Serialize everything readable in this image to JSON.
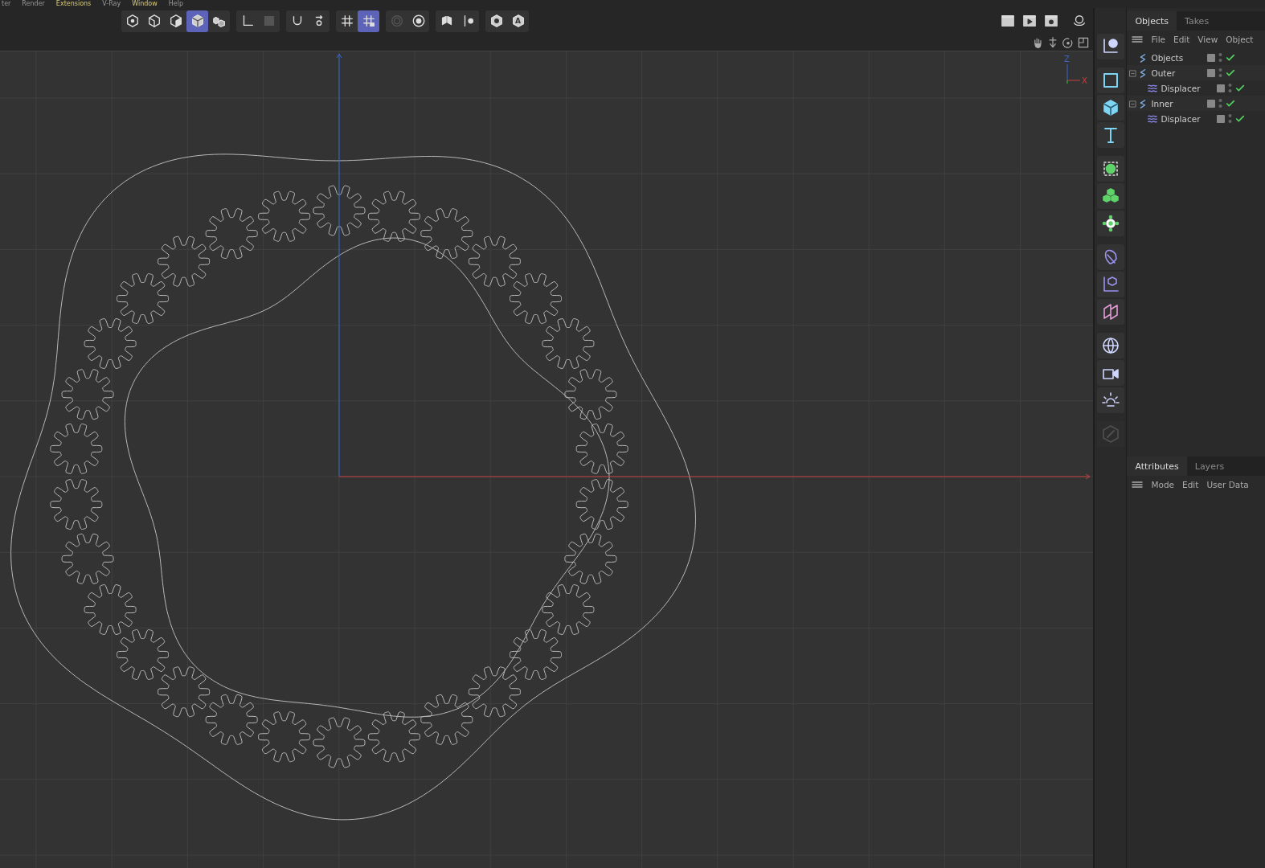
{
  "menu": [
    {
      "label": "ter",
      "highlighted": false
    },
    {
      "label": "Render",
      "highlighted": false
    },
    {
      "label": "Extensions",
      "highlighted": true
    },
    {
      "label": "V-Ray",
      "highlighted": false
    },
    {
      "label": "Window",
      "highlighted": true
    },
    {
      "label": "Help",
      "highlighted": false
    }
  ],
  "toolbar": {
    "groups": [
      {
        "tools": [
          {
            "selected": false,
            "disabled": false
          },
          {
            "selected": false,
            "disabled": false
          },
          {
            "selected": false,
            "disabled": false
          },
          {
            "selected": true,
            "disabled": false
          },
          {
            "selected": false,
            "disabled": false
          }
        ]
      },
      {
        "tools": [
          {
            "selected": false,
            "disabled": false
          },
          {
            "selected": false,
            "disabled": true
          }
        ]
      },
      {
        "tools": [
          {
            "selected": false,
            "disabled": false
          },
          {
            "selected": false,
            "disabled": false
          }
        ]
      },
      {
        "tools": [
          {
            "selected": false,
            "disabled": false
          },
          {
            "selected": true,
            "disabled": false
          }
        ]
      },
      {
        "tools": [
          {
            "selected": false,
            "disabled": true
          },
          {
            "selected": false,
            "disabled": false
          }
        ]
      },
      {
        "tools": [
          {
            "selected": false,
            "disabled": false
          },
          {
            "selected": false,
            "disabled": false
          }
        ]
      },
      {
        "tools": [
          {
            "selected": false,
            "disabled": false
          },
          {
            "selected": false,
            "disabled": false,
            "label": "A"
          }
        ]
      }
    ],
    "render_tools": [
      {
        "selected": false,
        "disabled": false
      },
      {
        "selected": false,
        "disabled": false
      },
      {
        "selected": false,
        "disabled": false
      },
      {
        "selected": false,
        "disabled": false
      }
    ]
  },
  "viewport": {
    "gizmo": {
      "up": "Z",
      "right": "X"
    }
  },
  "palette": [
    {
      "disabled": false
    },
    {
      "disabled": false
    },
    {
      "disabled": false
    },
    {
      "disabled": false
    },
    {
      "disabled": false
    },
    {
      "disabled": false
    },
    {
      "disabled": false
    },
    {
      "disabled": false
    },
    {
      "disabled": false
    },
    {
      "disabled": false
    },
    {
      "disabled": false
    },
    {
      "disabled": false
    },
    {
      "disabled": false
    },
    {
      "disabled": true
    }
  ],
  "objects_panel": {
    "tabs": [
      {
        "label": "Objects",
        "selected": true
      },
      {
        "label": "Takes",
        "selected": false
      }
    ],
    "menu": [
      "File",
      "Edit",
      "View",
      "Object"
    ],
    "tree": [
      {
        "name": "Objects",
        "kind": "null",
        "enabled": true
      },
      {
        "name": "Outer",
        "kind": "null",
        "enabled": true,
        "expanded": true,
        "children": [
          {
            "name": "Displacer",
            "kind": "displacer",
            "enabled": true
          }
        ]
      },
      {
        "name": "Inner",
        "kind": "null",
        "enabled": true,
        "expanded": true,
        "children": [
          {
            "name": "Displacer",
            "kind": "displacer",
            "enabled": true
          }
        ]
      }
    ]
  },
  "attributes_panel": {
    "tabs": [
      {
        "label": "Attributes",
        "selected": true
      },
      {
        "label": "Layers",
        "selected": false
      }
    ],
    "menu": [
      "Mode",
      "Edit",
      "User Data"
    ]
  }
}
